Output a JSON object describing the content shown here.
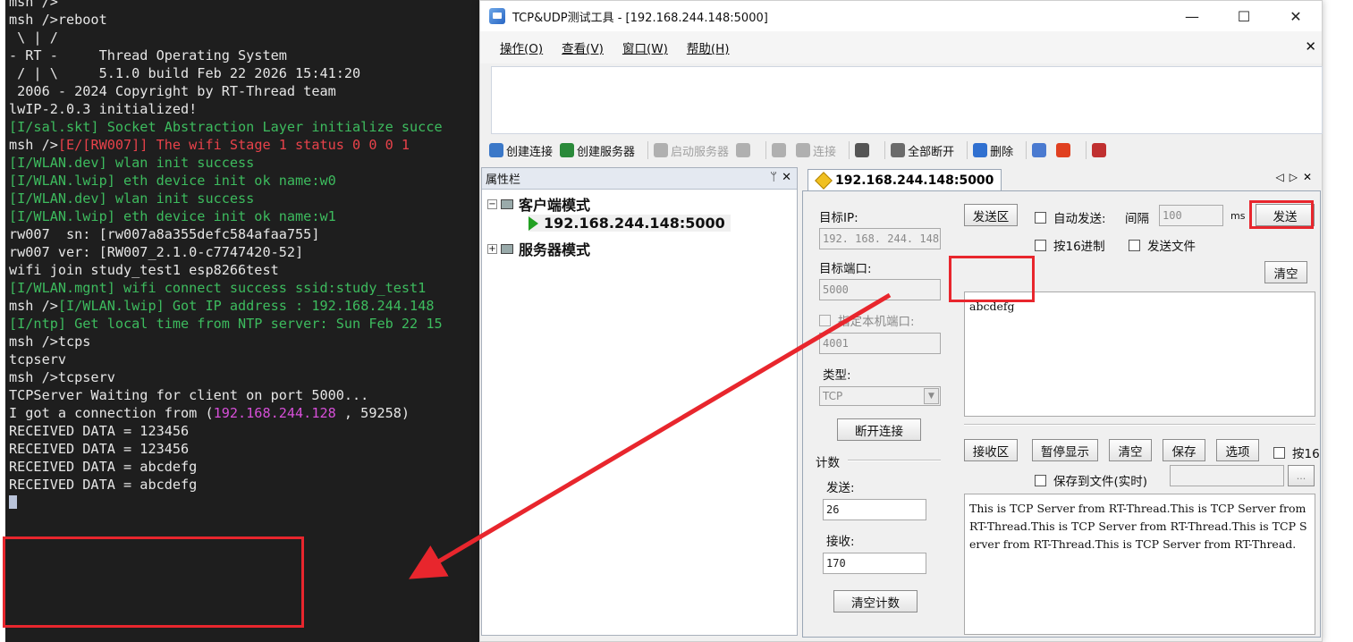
{
  "terminal": {
    "lines": [
      {
        "t": "msh />"
      },
      {
        "t": "msh />reboot"
      },
      {
        "t": ""
      },
      {
        "t": " \\ | /"
      },
      {
        "t": "- RT -     Thread Operating System"
      },
      {
        "t": " / | \\     5.1.0 build Feb 22 2026 15:41:20"
      },
      {
        "t": " 2006 - 2024 Copyright by RT-Thread team"
      },
      {
        "t": "lwIP-2.0.3 initialized!"
      },
      {
        "t": "[I/sal.skt] Socket Abstraction Layer initialize succe",
        "c": "g"
      },
      {
        "p": "msh />",
        "t": "[E/[RW007]] The wifi Stage 1 status 0 0 0 1",
        "c": "r"
      },
      {
        "t": "[I/WLAN.dev] wlan init success",
        "c": "g"
      },
      {
        "t": "[I/WLAN.lwip] eth device init ok name:w0",
        "c": "g"
      },
      {
        "t": "[I/WLAN.dev] wlan init success",
        "c": "g"
      },
      {
        "t": "[I/WLAN.lwip] eth device init ok name:w1",
        "c": "g"
      },
      {
        "t": ""
      },
      {
        "t": "rw007  sn: [rw007a8a355defc584afaa755]"
      },
      {
        "t": "rw007 ver: [RW007_2.1.0-c7747420-52]"
      },
      {
        "t": ""
      },
      {
        "t": "wifi join study_test1 esp8266test"
      },
      {
        "t": "[I/WLAN.mgnt] wifi connect success ssid:study_test1",
        "c": "g"
      },
      {
        "p": "msh />",
        "t": "[I/WLAN.lwip] Got IP address : 192.168.244.148",
        "c": "g"
      },
      {
        "t": "[I/ntp] Get local time from NTP server: Sun Feb 22 15",
        "c": "g"
      },
      {
        "t": ""
      },
      {
        "t": ""
      },
      {
        "t": "msh />tcps"
      },
      {
        "t": "tcpserv"
      },
      {
        "t": "msh />tcpserv"
      },
      {
        "t": ""
      },
      {
        "t": "TCPServer Waiting for client on port 5000..."
      },
      {
        "t": "I got a connection from (",
        "m": "192.168.244.128",
        "s": " , 59258)"
      },
      {
        "t": "RECEIVED DATA = 123456"
      },
      {
        "t": "RECEIVED DATA = 123456"
      },
      {
        "t": "RECEIVED DATA = abcdefg"
      },
      {
        "t": "RECEIVED DATA = abcdefg"
      }
    ]
  },
  "window": {
    "title": "TCP&UDP测试工具 - [192.168.244.148:5000]",
    "controls": {
      "minimize": "—",
      "maximize": "☐",
      "close": "✕"
    },
    "menu": [
      "操作(O)",
      "查看(V)",
      "窗口(W)",
      "帮助(H)"
    ],
    "menu_close": "✕"
  },
  "toolbar": [
    {
      "label": "创建连接",
      "enabled": true,
      "color": "#3b78c8"
    },
    {
      "label": "创建服务器",
      "enabled": true,
      "color": "#2a8a3a"
    },
    {
      "label": "启动服务器",
      "enabled": false,
      "color": "#b0b0b0"
    },
    {
      "label": "",
      "enabled": false,
      "color": "#b0b0b0"
    },
    {
      "label": "",
      "enabled": false,
      "color": "#b0b0b0"
    },
    {
      "label": "连接",
      "enabled": false,
      "color": "#b0b0b0"
    },
    {
      "label": "",
      "enabled": true,
      "color": "#555555"
    },
    {
      "label": "全部断开",
      "enabled": true,
      "color": "#6b6b6b"
    },
    {
      "label": "删除",
      "enabled": true,
      "color": "#3070d0"
    },
    {
      "label": "",
      "enabled": true,
      "color": "#4a7ad0"
    },
    {
      "label": "",
      "enabled": true,
      "color": "#e04020"
    },
    {
      "label": "",
      "enabled": true,
      "color": "#c03030"
    }
  ],
  "panel": {
    "title": "属性栏",
    "pin": "ᛘ",
    "close": "✕",
    "tree": {
      "client_mode": "客户端模式",
      "connection": "192.168.244.148:5000",
      "server_mode": "服务器模式"
    }
  },
  "tab": {
    "label": "192.168.244.148:5000",
    "nav": "◁▷✕"
  },
  "conn": {
    "target_ip_label": "目标IP:",
    "target_ip": "192. 168. 244. 148",
    "target_port_label": "目标端口:",
    "target_port": "5000",
    "local_port_label": "指定本机端口:",
    "local_port": "4001",
    "type_label": "类型:",
    "type": "TCP",
    "disconnect": "断开连接",
    "count_label": "计数",
    "send_count_label": "发送:",
    "send_count": "26",
    "recv_count_label": "接收:",
    "recv_count": "170",
    "clear_count": "清空计数"
  },
  "send": {
    "area_label": "发送区",
    "auto_send": "自动发送:",
    "interval_label": "间隔",
    "interval": "100",
    "ms": "ms",
    "send_button": "发送",
    "hex": "按16进制",
    "send_file": "发送文件",
    "clear": "清空",
    "text": "abcdefg"
  },
  "recv": {
    "area_label": "接收区",
    "pause": "暂停显示",
    "clear": "清空",
    "save": "保存",
    "options": "选项",
    "hex": "按16",
    "save_file": "保存到文件(实时)",
    "browse": "...",
    "text": "This is TCP Server from RT-Thread.This is TCP Server from RT-Thread.This is TCP Server from RT-Thread.This is TCP Server from RT-Thread.This is TCP Server from RT-Thread."
  },
  "colors": {
    "annotation": "#e8262d",
    "terminal_bg": "#1e1e1e",
    "green": "#3dbb5e",
    "red": "#e8424a",
    "magenta": "#d64fd8"
  }
}
